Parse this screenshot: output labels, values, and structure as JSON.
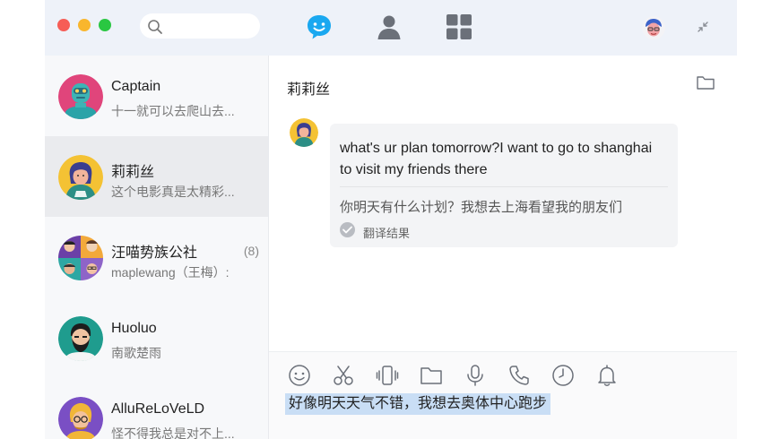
{
  "window": {
    "traffic_lights": [
      "close",
      "minimize",
      "maximize"
    ],
    "colors": {
      "close": "#f65d56",
      "minimize": "#f9b62d",
      "maximize": "#2ac742",
      "accent": "#1aa8f0"
    }
  },
  "topbar": {
    "search_placeholder": "",
    "nav": [
      {
        "icon": "chat-bubble-icon",
        "active": true
      },
      {
        "icon": "contacts-person-icon",
        "active": false
      },
      {
        "icon": "apps-grid-icon",
        "active": false
      }
    ],
    "right_icons": [
      "user-avatar-icon",
      "shrink-window-icon"
    ]
  },
  "conversations": [
    {
      "name": "Captain",
      "preview": "十一就可以去爬山去...",
      "count": "",
      "active": false,
      "avatar": "robot-avatar"
    },
    {
      "name": "莉莉丝",
      "preview": "这个电影真是太精彩...",
      "count": "",
      "active": true,
      "avatar": "girl-avatar"
    },
    {
      "name": "汪喵势族公社",
      "preview": "maplewang（王梅）:",
      "count": "(8)",
      "active": false,
      "avatar": "group-avatar"
    },
    {
      "name": "Huoluo",
      "preview": "南歌楚雨",
      "count": "",
      "active": false,
      "avatar": "bearded-man-avatar"
    },
    {
      "name": "AlluReLoVeLD",
      "preview": "怪不得我总是对不上...",
      "count": "",
      "active": false,
      "avatar": "glasses-man-avatar"
    }
  ],
  "chat": {
    "title": "莉莉丝",
    "messages": [
      {
        "sender": "莉莉丝",
        "text": "what's ur plan tomorrow?I want to go to shanghai to visit my friends there",
        "translation": "你明天有什么计划？我想去上海看望我的朋友们",
        "translation_label": "翻译结果"
      }
    ]
  },
  "composer": {
    "tools": [
      "emoji-icon",
      "scissors-icon",
      "vibrate-icon",
      "folder-icon",
      "microphone-icon",
      "phone-icon",
      "clock-icon",
      "bell-icon"
    ],
    "draft_text": "好像明天天气不错，我想去奥体中心跑步"
  }
}
